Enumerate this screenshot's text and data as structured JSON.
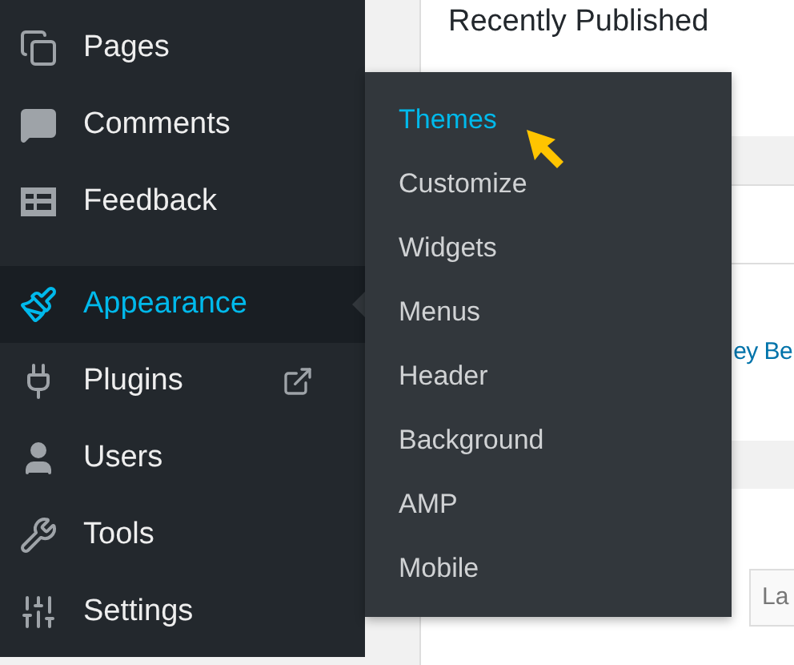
{
  "sidebar": {
    "items": [
      {
        "label": "Pages",
        "selected": false,
        "external": false
      },
      {
        "label": "Comments",
        "selected": false,
        "external": false
      },
      {
        "label": "Feedback",
        "selected": false,
        "external": false
      },
      {
        "label": "Appearance",
        "selected": true,
        "external": false
      },
      {
        "label": "Plugins",
        "selected": false,
        "external": true
      },
      {
        "label": "Users",
        "selected": false,
        "external": false
      },
      {
        "label": "Tools",
        "selected": false,
        "external": false
      },
      {
        "label": "Settings",
        "selected": false,
        "external": false
      }
    ]
  },
  "submenu": {
    "items": [
      {
        "label": "Themes",
        "selected": true
      },
      {
        "label": "Customize",
        "selected": false
      },
      {
        "label": "Widgets",
        "selected": false
      },
      {
        "label": "Menus",
        "selected": false
      },
      {
        "label": "Header",
        "selected": false
      },
      {
        "label": "Background",
        "selected": false
      },
      {
        "label": "AMP",
        "selected": false
      },
      {
        "label": "Mobile",
        "selected": false
      }
    ]
  },
  "content": {
    "heading": "Recently Published",
    "link": "ey Be",
    "tab": "La"
  }
}
